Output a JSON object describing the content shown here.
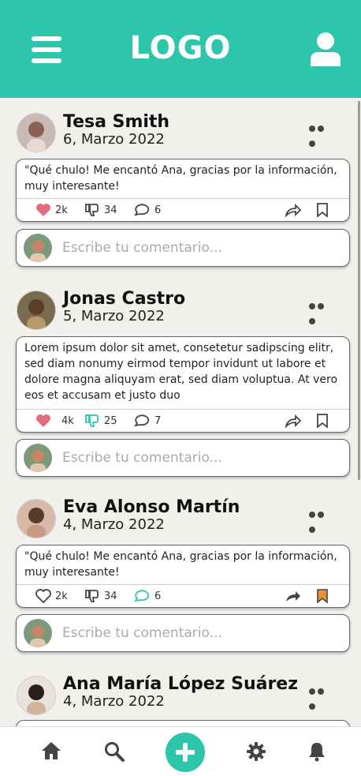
{
  "header": {
    "logo_text": "LOGO"
  },
  "colors": {
    "accent": "#2dc5ac",
    "like": "#e06c7c",
    "bookmark": "#e8923a"
  },
  "comment_placeholder": "Escribe tu comentario...",
  "posts": [
    {
      "name": "Tesa Smith",
      "date": "6, Marzo 2022",
      "text": "\"Qué chulo! Me encantó Ana, gracias por la información, muy interesante!",
      "likes": "2k",
      "dislikes": "34",
      "comments": "6"
    },
    {
      "name": "Jonas Castro",
      "date": "5, Marzo 2022",
      "text": "Lorem ipsum dolor sit amet, consetetur sadipscing elitr, sed diam nonumy eirmod tempor invidunt ut labore et dolore magna aliquyam erat, sed diam voluptua. At vero eos et accusam et justo duo",
      "likes": "4k",
      "dislikes": "25",
      "comments": "7"
    },
    {
      "name": "Eva Alonso Martín",
      "date": "4, Marzo 2022",
      "text": "\"Qué chulo! Me encantó Ana, gracias por la información, muy interesante!",
      "likes": "2k",
      "dislikes": "34",
      "comments": "6"
    },
    {
      "name": "Ana María López Suárez",
      "date": "4, Marzo 2022"
    }
  ],
  "nav": [
    "home-icon",
    "search-icon",
    "plus-icon",
    "gear-icon",
    "bell-icon"
  ]
}
